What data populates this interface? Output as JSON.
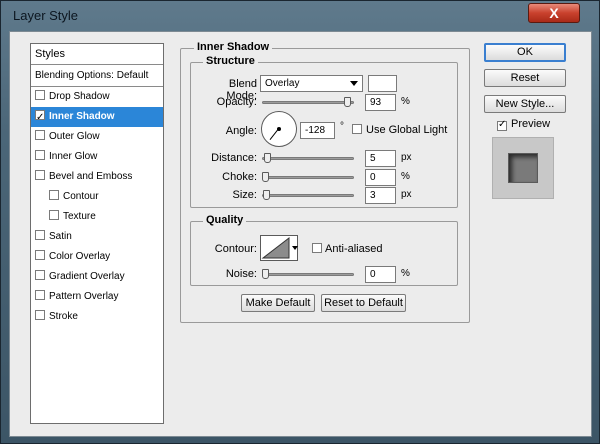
{
  "window": {
    "title": "Layer Style",
    "close_symbol": "X"
  },
  "styles": {
    "header": "Styles",
    "blending": "Blending Options: Default",
    "items": [
      {
        "label": "Drop Shadow",
        "checked": false,
        "selected": false,
        "indent": false
      },
      {
        "label": "Inner Shadow",
        "checked": true,
        "selected": true,
        "indent": false
      },
      {
        "label": "Outer Glow",
        "checked": false,
        "selected": false,
        "indent": false
      },
      {
        "label": "Inner Glow",
        "checked": false,
        "selected": false,
        "indent": false
      },
      {
        "label": "Bevel and Emboss",
        "checked": false,
        "selected": false,
        "indent": false
      },
      {
        "label": "Contour",
        "checked": false,
        "selected": false,
        "indent": true
      },
      {
        "label": "Texture",
        "checked": false,
        "selected": false,
        "indent": true
      },
      {
        "label": "Satin",
        "checked": false,
        "selected": false,
        "indent": false
      },
      {
        "label": "Color Overlay",
        "checked": false,
        "selected": false,
        "indent": false
      },
      {
        "label": "Gradient Overlay",
        "checked": false,
        "selected": false,
        "indent": false
      },
      {
        "label": "Pattern Overlay",
        "checked": false,
        "selected": false,
        "indent": false
      },
      {
        "label": "Stroke",
        "checked": false,
        "selected": false,
        "indent": false
      }
    ]
  },
  "buttons": {
    "ok": "OK",
    "reset": "Reset",
    "new_style": "New Style...",
    "preview": "Preview",
    "preview_checked": true
  },
  "inner_shadow": {
    "title": "Inner Shadow",
    "structure": {
      "title": "Structure",
      "blend_mode_label": "Blend Mode:",
      "blend_mode_value": "Overlay",
      "opacity_label": "Opacity:",
      "opacity_value": "93",
      "opacity_unit": "%",
      "opacity_fraction": 0.93,
      "angle_label": "Angle:",
      "angle_value": "-128",
      "angle_unit": "°",
      "use_global_light_label": "Use Global Light",
      "use_global_light_checked": false,
      "distance_label": "Distance:",
      "distance_value": "5",
      "distance_unit": "px",
      "choke_label": "Choke:",
      "choke_value": "0",
      "choke_unit": "%",
      "size_label": "Size:",
      "size_value": "3",
      "size_unit": "px"
    },
    "quality": {
      "title": "Quality",
      "contour_label": "Contour:",
      "anti_aliased_label": "Anti-aliased",
      "anti_aliased_checked": false,
      "noise_label": "Noise:",
      "noise_value": "0",
      "noise_unit": "%"
    },
    "make_default": "Make Default",
    "reset_to_default": "Reset to Default"
  },
  "colors": {
    "selection": "#2b86d8",
    "close": "#c9412d",
    "accent_border": "#3a7fd0"
  }
}
